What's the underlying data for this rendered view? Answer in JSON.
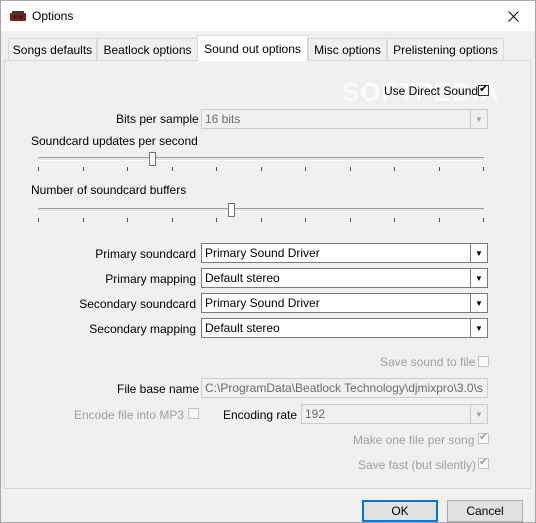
{
  "window": {
    "title": "Options"
  },
  "tabs": [
    {
      "label": "Songs defaults"
    },
    {
      "label": "Beatlock options"
    },
    {
      "label": "Sound out options"
    },
    {
      "label": "Misc options"
    },
    {
      "label": "Prelistening options"
    }
  ],
  "sound_out": {
    "use_direct_sound": {
      "label": "Use Direct Sound",
      "checked": true
    },
    "bits_per_sample": {
      "label": "Bits per sample",
      "value": "16 bits"
    },
    "soundcard_updates": {
      "label": "Soundcard updates per second"
    },
    "soundcard_buffers": {
      "label": "Number of soundcard buffers"
    },
    "primary_soundcard": {
      "label": "Primary soundcard",
      "value": "Primary Sound Driver"
    },
    "primary_mapping": {
      "label": "Primary mapping",
      "value": "Default stereo"
    },
    "secondary_soundcard": {
      "label": "Secondary soundcard",
      "value": "Primary Sound Driver"
    },
    "secondary_mapping": {
      "label": "Secondary mapping",
      "value": "Default stereo"
    },
    "save_sound_to_file": {
      "label": "Save sound to file",
      "checked": false
    },
    "file_base_name": {
      "label": "File base name",
      "value": "C:\\ProgramData\\Beatlock Technology\\djmixpro\\3.0\\s"
    },
    "encode_mp3": {
      "label": "Encode file into MP3",
      "checked": false
    },
    "encoding_rate": {
      "label": "Encoding rate",
      "value": "192"
    },
    "one_file_per_song": {
      "label": "Make one file per song",
      "checked": true
    },
    "save_fast": {
      "label": "Save fast (but silently)",
      "checked": true
    }
  },
  "buttons": {
    "ok": "OK",
    "cancel": "Cancel"
  },
  "icons": {
    "close": "close-icon",
    "app": "app-icon"
  }
}
